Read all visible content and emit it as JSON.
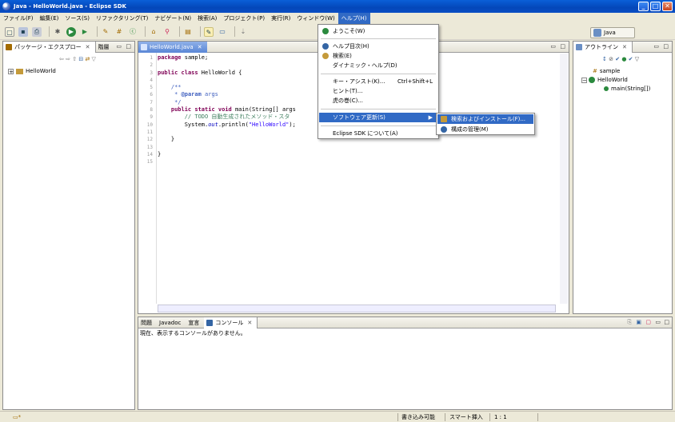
{
  "window": {
    "title": "Java - HelloWorld.java - Eclipse SDK",
    "buttons": {
      "minimize": "_",
      "maximize": "□",
      "close": "✕"
    }
  },
  "menubar": [
    "ファイル(F)",
    "編集(E)",
    "ソース(S)",
    "リファクタリング(T)",
    "ナビゲート(N)",
    "検索(A)",
    "プロジェクト(P)",
    "実行(R)",
    "ウィンドウ(W)",
    "ヘルプ(H)"
  ],
  "toolbar": {
    "icons": [
      "new-icon",
      "save-icon",
      "print-icon",
      "debug-icon",
      "run-icon",
      "external-tools-icon",
      "new-java-project-icon",
      "new-package-icon",
      "new-class-icon",
      "open-type-icon",
      "search-icon",
      "toggle-mark-icon",
      "next-annotation-icon",
      "back-icon",
      "forward-icon"
    ],
    "perspective_label": "Java"
  },
  "package_explorer": {
    "tabs": [
      "パッケージ・エクスプロー",
      "階層"
    ],
    "tree": [
      {
        "label": "HelloWorld",
        "expanded": false
      }
    ]
  },
  "editor": {
    "tab_label": "HelloWorld.java",
    "line_numbers": [
      "1",
      "2",
      "3",
      "4",
      "5",
      "6",
      "7",
      "8",
      "9",
      "10",
      "11",
      "12",
      "13",
      "14",
      "15"
    ]
  },
  "help_menu": {
    "items": [
      {
        "label": "ようこそ(W)",
        "icon": "welcome-icon",
        "accel": ""
      },
      {
        "label": "ヘルプ目次(H)",
        "icon": "help-contents-icon",
        "accel": ""
      },
      {
        "label": "検索(E)",
        "icon": "help-search-icon",
        "accel": ""
      },
      {
        "label": "ダイナミック・ヘルプ(D)",
        "icon": "",
        "accel": ""
      },
      {
        "label": "キー・アシスト(K)...",
        "icon": "",
        "accel": "Ctrl+Shift+L"
      },
      {
        "label": "ヒント(T)...",
        "icon": "",
        "accel": ""
      },
      {
        "label": "虎の巻(C)...",
        "icon": "",
        "accel": ""
      },
      {
        "label": "ソフトウェア更新(S)",
        "icon": "",
        "accel": ""
      },
      {
        "label": "Eclipse SDK について(A)",
        "icon": "",
        "accel": ""
      }
    ]
  },
  "software_update_submenu": [
    {
      "label": "検索およびインストール(F)...",
      "icon": "find-install-icon"
    },
    {
      "label": "構成の管理(M)",
      "icon": "manage-config-icon"
    }
  ],
  "outline": {
    "tab_label": "アウトライン",
    "tree": [
      {
        "label": "sample",
        "icon": "package-icon"
      },
      {
        "label": "HelloWorld",
        "icon": "class-icon"
      },
      {
        "label": "main(String[])",
        "icon": "method-icon"
      }
    ]
  },
  "console": {
    "tabs": [
      "問題",
      "Javadoc",
      "宣言",
      "コンソール"
    ],
    "message": "現在、表示するコンソールがありません。"
  },
  "statusbar": {
    "writable": "書き込み可能",
    "insert_mode": "スマート挿入",
    "position": "1 : 1"
  }
}
